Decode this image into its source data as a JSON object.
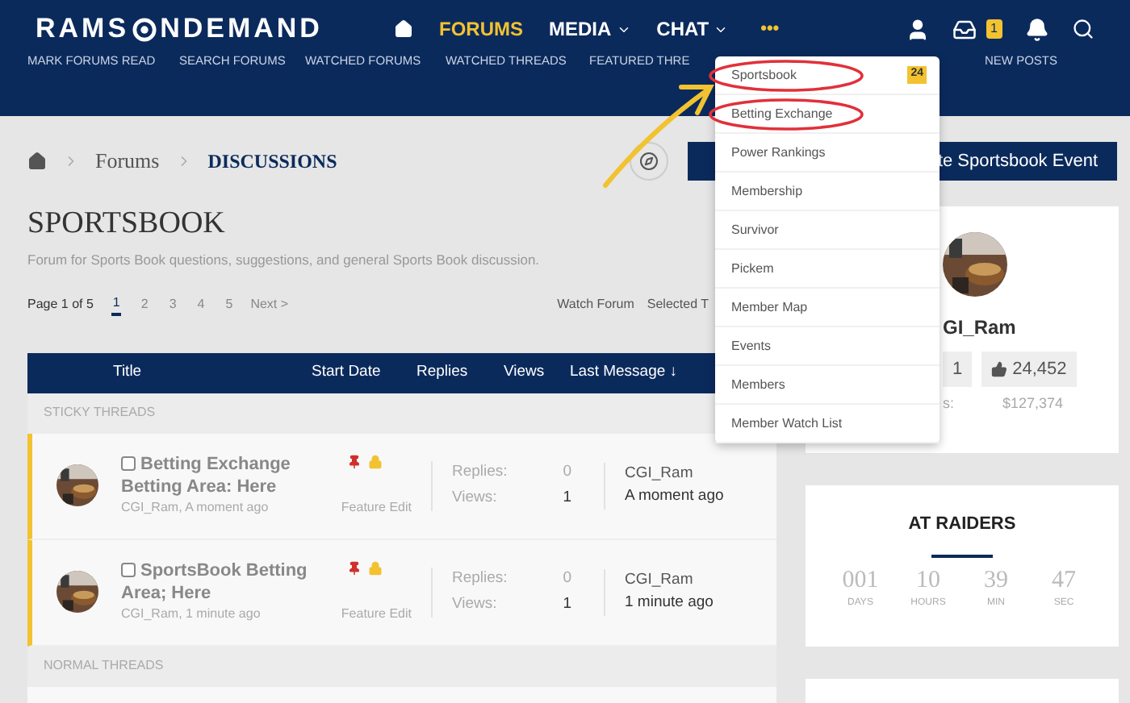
{
  "header": {
    "logo": [
      "RAMS",
      "NDEMAND"
    ],
    "nav": [
      {
        "kind": "home",
        "selected": false
      },
      {
        "kind": "text",
        "label": "FORUMS",
        "selected": true
      },
      {
        "kind": "menu",
        "label": "MEDIA",
        "selected": false
      },
      {
        "kind": "menu",
        "label": "CHAT",
        "selected": false
      },
      {
        "kind": "more",
        "label": "•••",
        "selected": true
      }
    ],
    "inbox_badge": "1",
    "subnav": [
      "MARK FORUMS READ",
      "SEARCH FORUMS",
      "WATCHED FORUMS",
      "WATCHED THREADS",
      "FEATURED THRE",
      "NEW POSTS"
    ]
  },
  "dropdown": {
    "items": [
      {
        "label": "Sportsbook",
        "badge": "24",
        "circled": true
      },
      {
        "label": "Betting Exchange",
        "circled": true
      },
      {
        "label": "Power Rankings",
        "circled": false
      },
      {
        "label": "Membership",
        "circled": false
      },
      {
        "label": "Survivor",
        "circled": false
      },
      {
        "label": "Pickem",
        "circled": false
      },
      {
        "label": "Member Map",
        "circled": false
      },
      {
        "label": "Events",
        "circled": false
      },
      {
        "label": "Members",
        "circled": false
      },
      {
        "label": "Member Watch List",
        "circled": false
      }
    ]
  },
  "breadcrumb": [
    "Forums",
    "DISCUSSIONS"
  ],
  "create_button": "te Sportsbook Event",
  "forum": {
    "title": "SPORTSBOOK",
    "description": "Forum for Sports Book questions, suggestions, and general Sports Book discussion.",
    "page_label": "Page 1 of 5",
    "pages": [
      {
        "label": "1",
        "selected": true
      },
      {
        "label": "2",
        "selected": false
      },
      {
        "label": "3",
        "selected": false
      },
      {
        "label": "4",
        "selected": false
      },
      {
        "label": "5",
        "selected": false
      }
    ],
    "next": "Next >",
    "actions": [
      "Watch Forum",
      "Selected T"
    ]
  },
  "table": {
    "columns": [
      "Title",
      "Start Date",
      "Replies",
      "Views",
      "Last Message ↓"
    ],
    "sections": [
      {
        "label": "STICKY THREADS",
        "rows": [
          {
            "checked": false,
            "title": "Betting Exchange Betting Area: Here",
            "meta": "CGI_Ram, A moment ago",
            "feature": "Feature Edit",
            "replies_label": "Replies:",
            "replies": "0",
            "views_label": "Views:",
            "views": "1",
            "last_user": "CGI_Ram",
            "last_time": "A moment ago"
          },
          {
            "checked": false,
            "title": "SportsBook Betting Area; Here",
            "meta": "CGI_Ram, 1 minute ago",
            "feature": "Feature Edit",
            "replies_label": "Replies:",
            "replies": "0",
            "views_label": "Views:",
            "views": "1",
            "last_user": "CGI_Ram",
            "last_time": "1 minute ago"
          }
        ]
      },
      {
        "label": "NORMAL THREADS"
      }
    ]
  },
  "profile": {
    "name": "GI_Ram",
    "stat_1": "1",
    "likes": "24,452",
    "label": "s:",
    "value": "$127,374"
  },
  "countdown": {
    "title": "AT RAIDERS",
    "units": [
      {
        "value": "001",
        "label": "DAYS"
      },
      {
        "value": "10",
        "label": "HOURS"
      },
      {
        "value": "39",
        "label": "MIN"
      },
      {
        "value": "47",
        "label": "SEC"
      }
    ]
  }
}
